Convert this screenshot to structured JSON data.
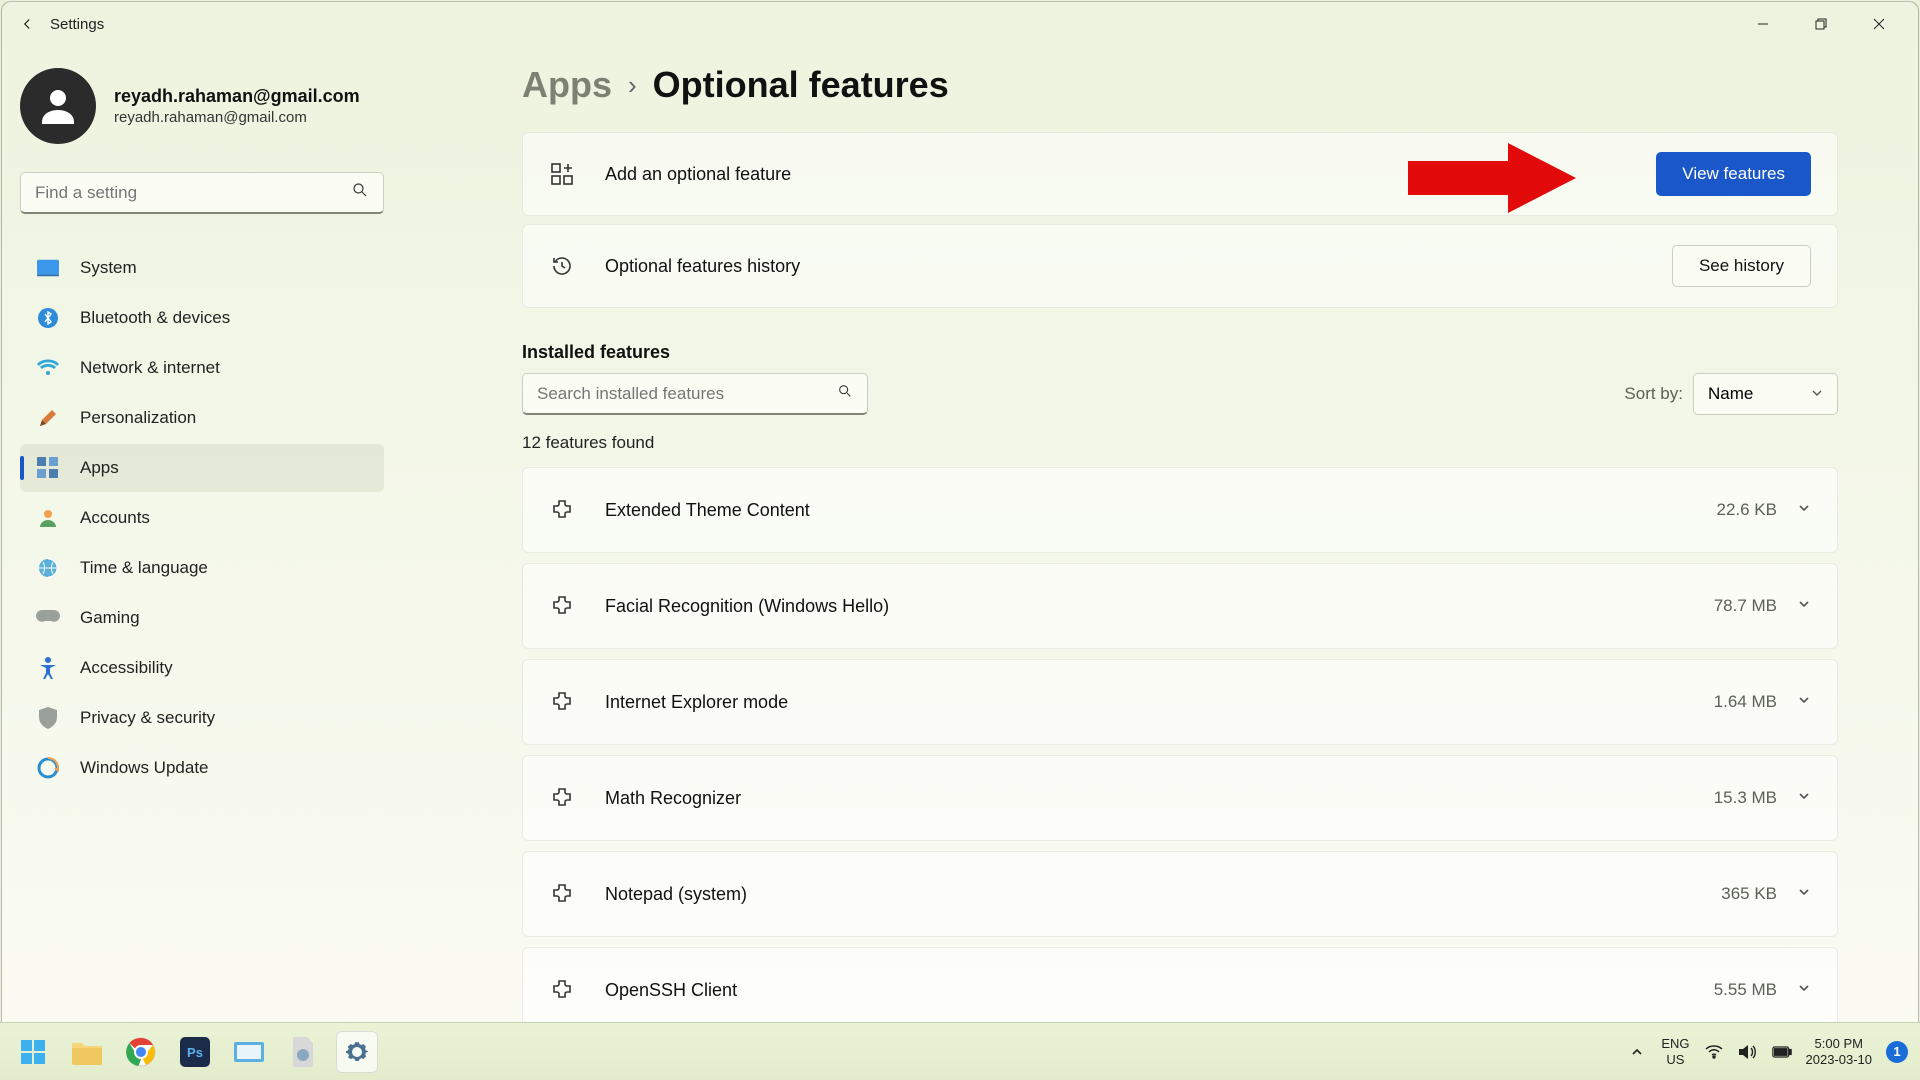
{
  "window": {
    "title": "Settings"
  },
  "profile": {
    "name": "reyadh.rahaman@gmail.com",
    "email": "reyadh.rahaman@gmail.com"
  },
  "search": {
    "placeholder": "Find a setting"
  },
  "nav": [
    {
      "label": "System"
    },
    {
      "label": "Bluetooth & devices"
    },
    {
      "label": "Network & internet"
    },
    {
      "label": "Personalization"
    },
    {
      "label": "Apps"
    },
    {
      "label": "Accounts"
    },
    {
      "label": "Time & language"
    },
    {
      "label": "Gaming"
    },
    {
      "label": "Accessibility"
    },
    {
      "label": "Privacy & security"
    },
    {
      "label": "Windows Update"
    }
  ],
  "breadcrumb": {
    "parent": "Apps",
    "current": "Optional features"
  },
  "cards": {
    "add": {
      "label": "Add an optional feature",
      "button": "View features"
    },
    "history": {
      "label": "Optional features history",
      "button": "See history"
    }
  },
  "installed": {
    "title": "Installed features",
    "search_placeholder": "Search installed features",
    "sort_label": "Sort by:",
    "sort_value": "Name",
    "count_text": "12 features found",
    "items": [
      {
        "name": "Extended Theme Content",
        "size": "22.6 KB"
      },
      {
        "name": "Facial Recognition (Windows Hello)",
        "size": "78.7 MB"
      },
      {
        "name": "Internet Explorer mode",
        "size": "1.64 MB"
      },
      {
        "name": "Math Recognizer",
        "size": "15.3 MB"
      },
      {
        "name": "Notepad (system)",
        "size": "365 KB"
      },
      {
        "name": "OpenSSH Client",
        "size": "5.55 MB"
      }
    ]
  },
  "taskbar": {
    "lang1": "ENG",
    "lang2": "US",
    "time": "5:00 PM",
    "date": "2023-03-10",
    "notif": "1"
  }
}
